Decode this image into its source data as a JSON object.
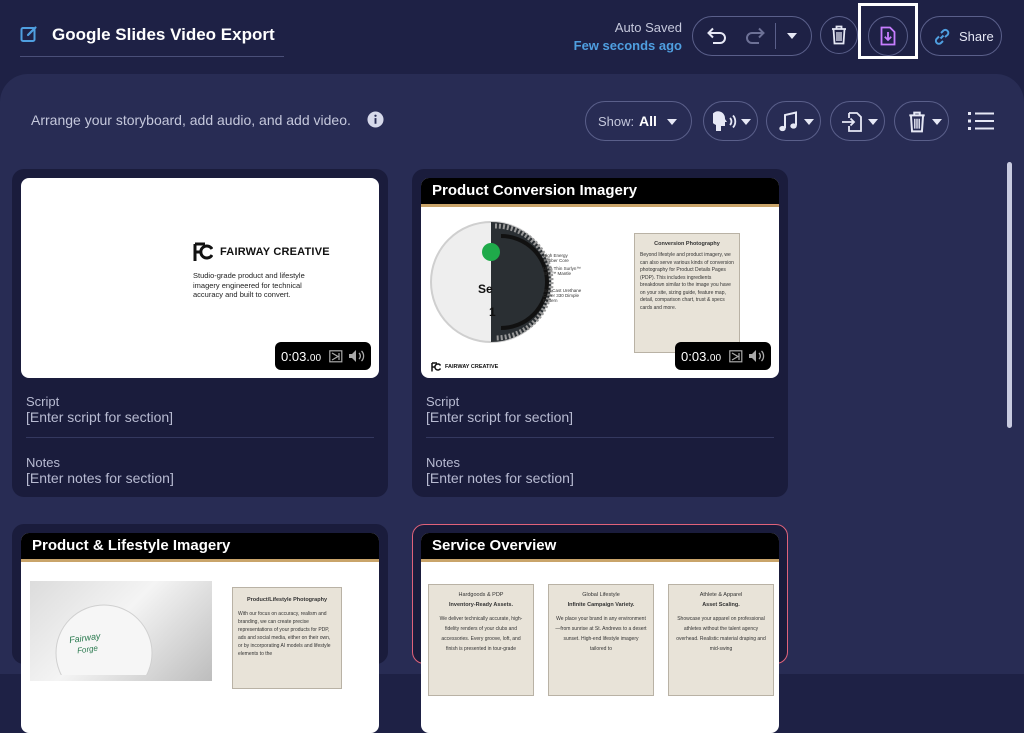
{
  "header": {
    "title": "Google Slides Video Export",
    "autosave_label": "Auto Saved",
    "autosave_time": "Few seconds ago",
    "share_label": "Share",
    "export_highlight_color": "#ffffff"
  },
  "toolbar": {
    "hint": "Arrange your storyboard, add audio, and add video.",
    "show_label": "Show:",
    "show_value": "All",
    "tools": [
      "voice-icon",
      "music-icon",
      "import-icon",
      "trash-icon"
    ]
  },
  "cards": [
    {
      "slide_title": "",
      "brand": "FAIRWAY CREATIVE",
      "tagline": "Studio-grade product and lifestyle imagery engineered for technical accuracy and built to convert.",
      "duration": "0:03.",
      "duration_ms": "00",
      "script_label": "Script",
      "script_value": "[Enter script for section]",
      "notes_label": "Notes",
      "notes_value": "[Enter notes for section]"
    },
    {
      "slide_title": "Product Conversion Imagery",
      "box_title": "Conversion Photography",
      "box_text": "Beyond lifestyle and product imagery, we can also serve various kinds of conversion photography for Product Details Pages (PDP). This includes ingredients breakdown similar to the image you have on your site, sizing guide, feature map, detail, comparison chart, trust & specs cards and more.",
      "ball_label_1": "Se",
      "ball_label_2": "1",
      "callout_1": "High Energy Rubber Core",
      "callout_2": "Ultra Thin Surlyn™ SPF™ Mantle",
      "callout_3": "Soft Cast Urethane Cover 330 Dimple Pattern",
      "footer_brand": "FAIRWAY CREATIVE",
      "duration": "0:03.",
      "duration_ms": "00",
      "script_label": "Script",
      "script_value": "[Enter script for section]",
      "notes_label": "Notes",
      "notes_value": "[Enter notes for section]"
    },
    {
      "slide_title": "Product & Lifestyle Imagery",
      "box_title": "Product/Lifestyle Photography",
      "box_text": "With our focus on accuracy, realism and branding, we can create precise representations of your products for PDP, ads and social media, either on their own, or by incorporating AI models and lifestyle elements to the",
      "ball_text_1": "Fairway",
      "ball_text_2": "Forge"
    },
    {
      "slide_title": "Service Overview",
      "columns": [
        {
          "heading": "Hardgoods & PDP",
          "subheading": "Inventory-Ready Assets.",
          "text": "We deliver technically accurate, high-fidelity renders of your clubs and accessories. Every groove, loft, and finish is presented in tour-grade"
        },
        {
          "heading": "Global Lifestyle",
          "subheading": "Infinite Campaign Variety.",
          "text": "We place your brand in any environment—from sunrise at St. Andrews to a desert sunset. High-end lifestyle imagery tailored to"
        },
        {
          "heading": "Athlete & Apparel",
          "subheading": "Asset Scaling.",
          "text": "Showcase your apparel on professional athletes without the talent agency overhead. Realistic material draping and mid-swing"
        }
      ]
    }
  ]
}
